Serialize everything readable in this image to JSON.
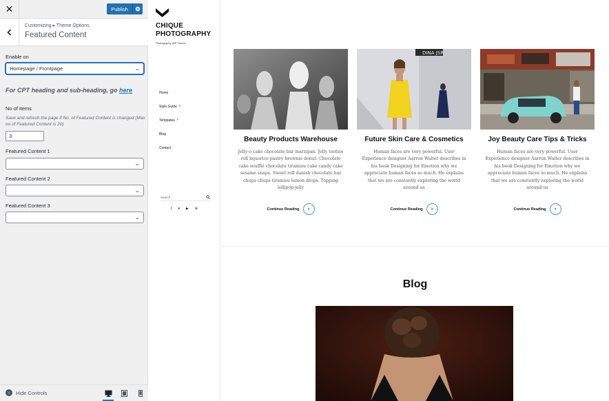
{
  "customizer": {
    "close_icon": "close-icon",
    "publish_label": "Publish",
    "breadcrumb": "Customizing ▸ Theme Options",
    "section_title": "Featured Content",
    "enable_on_label": "Enable on",
    "enable_on_value": "Homepage / Frontpage",
    "cpt_note": "For CPT heading and sub-heading, go",
    "cpt_link": "here",
    "no_items_label": "No of items",
    "no_items_desc": "Save and refresh the page if No. of Featured Content is changed (Max no of Featured Content is 20)",
    "no_items_value": "3",
    "featured_1_label": "Featured Content 1",
    "featured_2_label": "Featured Content 2",
    "featured_3_label": "Featured Content 3",
    "featured_1_value": "",
    "featured_2_value": "",
    "featured_3_value": "",
    "hide_controls": "Hide Controls",
    "accent": "#2271b1"
  },
  "site": {
    "brand_line1": "CHIQUE",
    "brand_line2": "PHOTOGRAPHY",
    "tagline": "Photography WP Theme",
    "nav": [
      {
        "label": "Home",
        "has_children": false
      },
      {
        "label": "Style Guide",
        "has_children": true
      },
      {
        "label": "Templates",
        "has_children": true
      },
      {
        "label": "Blog",
        "has_children": false
      },
      {
        "label": "Contact",
        "has_children": false
      }
    ],
    "search_placeholder": "Search ...",
    "socials": [
      "facebook-icon",
      "twitter-icon",
      "youtube-icon",
      "pinterest-icon"
    ],
    "cards": [
      {
        "title": "Beauty Products Warehouse",
        "excerpt": "Jelly-o cake chocolate bar marzipan. Jelly tootsie roll liquorice pastry brownie donut. Chocolate cake soufflé chocolate tiramisu cake candy cake sesame snaps. Sweet roll danish chocolate bar chupa chups tiramisu lemon drops. Topping lollipop jelly",
        "more": "Continue Reading"
      },
      {
        "title": "Future Skin Care & Cosmetics",
        "excerpt": "Human faces are very powerful. User Experience designer Aarron Walter describes in his book Designing for Emotion why we appreciate human faces so much. He explains that we are constantly exploring the world around us",
        "more": "Continue Reading"
      },
      {
        "title": "Joy Beauty Care Tips & Tricks",
        "excerpt": "Human faces are very powerful. User Experience designer Aarron Walter describes in his book Designing for Emotion why we appreciate human faces so much. He explains that we are constantly exploring the world around us",
        "more": "Continue Reading"
      }
    ],
    "blog_heading": "Blog",
    "accent": "#3aa89a"
  }
}
